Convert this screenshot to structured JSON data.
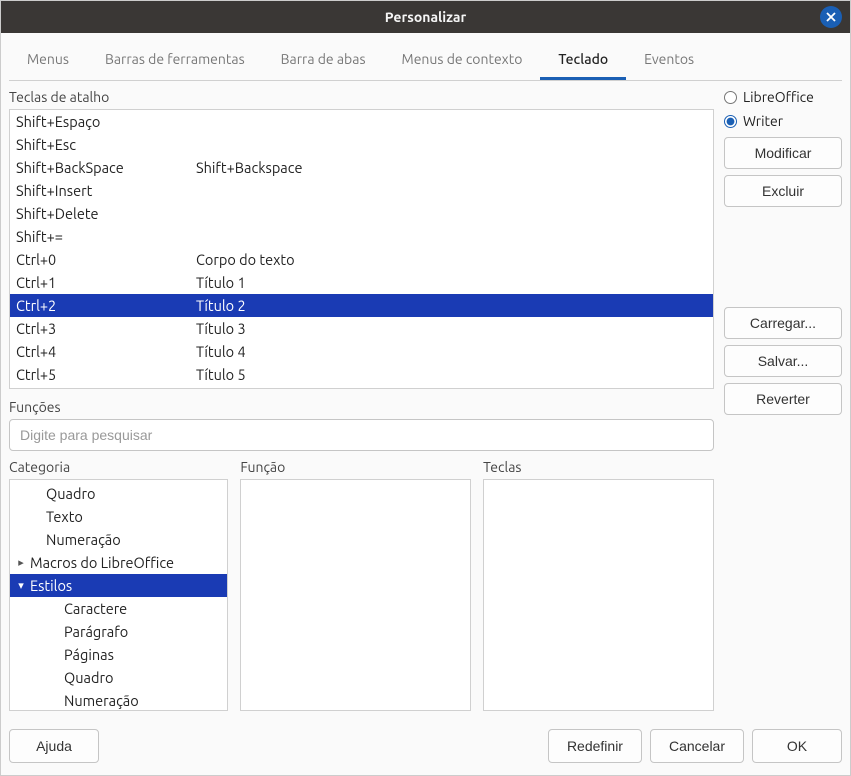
{
  "title": "Personalizar",
  "tabs": {
    "menus": "Menus",
    "toolbars": "Barras de ferramentas",
    "tabbar": "Barra de abas",
    "context": "Menus de contexto",
    "keyboard": "Teclado",
    "events": "Eventos"
  },
  "labels": {
    "shortcuts": "Teclas de atalho",
    "functions": "Funções",
    "category": "Categoria",
    "function": "Função",
    "keys": "Teclas"
  },
  "scope": {
    "libreoffice": "LibreOffice",
    "writer": "Writer"
  },
  "side_buttons": {
    "modify": "Modificar",
    "delete": "Excluir",
    "load": "Carregar...",
    "save": "Salvar...",
    "revert": "Reverter"
  },
  "search": {
    "placeholder": "Digite para pesquisar"
  },
  "shortcuts": [
    {
      "key": "Shift+Espaço",
      "func": ""
    },
    {
      "key": "Shift+Esc",
      "func": ""
    },
    {
      "key": "Shift+BackSpace",
      "func": "Shift+Backspace"
    },
    {
      "key": "Shift+Insert",
      "func": ""
    },
    {
      "key": "Shift+Delete",
      "func": ""
    },
    {
      "key": "Shift+=",
      "func": ""
    },
    {
      "key": "Ctrl+0",
      "func": "Corpo do texto"
    },
    {
      "key": "Ctrl+1",
      "func": "Título 1"
    },
    {
      "key": "Ctrl+2",
      "func": "Título 2",
      "selected": true
    },
    {
      "key": "Ctrl+3",
      "func": "Título 3"
    },
    {
      "key": "Ctrl+4",
      "func": "Título 4"
    },
    {
      "key": "Ctrl+5",
      "func": "Título 5"
    }
  ],
  "categories": [
    {
      "label": "Quadro",
      "indent": 1
    },
    {
      "label": "Texto",
      "indent": 1
    },
    {
      "label": "Numeração",
      "indent": 1
    },
    {
      "label": "Macros do LibreOffice",
      "indent": 0,
      "arrow": "right"
    },
    {
      "label": "Estilos",
      "indent": 0,
      "arrow": "down",
      "selected": true
    },
    {
      "label": "Caractere",
      "indent": 2
    },
    {
      "label": "Parágrafo",
      "indent": 2
    },
    {
      "label": "Páginas",
      "indent": 2
    },
    {
      "label": "Quadro",
      "indent": 2
    },
    {
      "label": "Numeração",
      "indent": 2
    }
  ],
  "bottom": {
    "help": "Ajuda",
    "reset": "Redefinir",
    "cancel": "Cancelar",
    "ok": "OK"
  }
}
